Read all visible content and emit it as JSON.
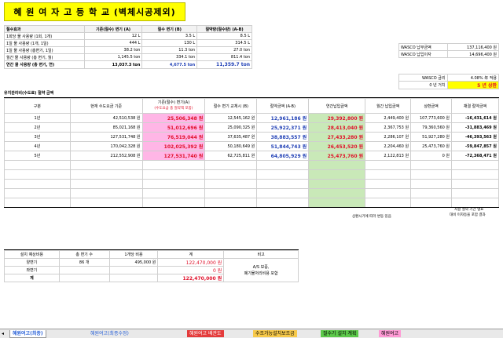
{
  "title": "혜 원 여 자 고 등 학 교 (벽체시공제외)",
  "summary": {
    "headers": [
      "절수효과",
      "기존(절수) 변기 (A)",
      "절수 변기 (B)",
      "절약량(절수량) (A-B)"
    ],
    "rows": [
      {
        "label": "1회당 물 사용량 (1회, 1개)",
        "a": "12 L",
        "b": "3.5 L",
        "c": "8.5 L"
      },
      {
        "label": "1일 물 사용량 (1개, 1일)",
        "a": "444 L",
        "b": "130 L",
        "c": "314.5 L"
      },
      {
        "label": "1일 물 사용량 (총변기, 1일)",
        "a": "38.2 ton",
        "b": "11.3 ton",
        "c": "27.0 ton"
      },
      {
        "label": "월간 물 사용량 (총 변기, 월)",
        "a": "1,145.5 ton",
        "b": "334.1 ton",
        "c": "811.4 ton"
      },
      {
        "label": "연간 물 사용량 (총 변기, 연)",
        "a": "13,037.3 ton",
        "b": "4,677.5 ton",
        "c": "11,359.7 ton"
      }
    ]
  },
  "wasco": {
    "pay_label": "WASCO 납부금액",
    "pay_value": "137,116,400 원",
    "interest_label": "WASCO 납입이자",
    "interest_value": "14,696,400 원",
    "rate_label": "WASCO 금리",
    "rate_value": "4.08% 年 적용",
    "period_label": "0 년 거치",
    "period_value": "5 년 상환"
  },
  "section2_title": "유지관리비(수도료) 절약 금액",
  "fee": {
    "headers": [
      "구분",
      "현재 수도요금 기준",
      "기존(절수) 변기(A)",
      "(수도요금 총 절약액 포함)",
      "절수 변기 교체시 (B)",
      "절약금액 (A-B)",
      "연간납입금액",
      "월간 납입금액",
      "상환금액",
      "채결 절약금액"
    ],
    "rows": [
      {
        "year": "1년",
        "cur": "42,510,538 원",
        "a": "25,506,348 원",
        "b": "12,545,162 원",
        "save": "12,961,186 원",
        "annual": "29,392,800 원",
        "monthly": "2,449,400 원",
        "repay": "107,773,600 원",
        "net": "-16,431,614 원"
      },
      {
        "year": "2년",
        "cur": "85,021,168 원",
        "a": "51,012,696 원",
        "b": "25,090,325 원",
        "save": "25,922,371 원",
        "annual": "28,413,040 원",
        "monthly": "2,367,753 원",
        "repay": "79,360,560 원",
        "net": "-31,883,469 원"
      },
      {
        "year": "3년",
        "cur": "127,531,748 원",
        "a": "76,519,044 원",
        "b": "37,635,487 원",
        "save": "38,883,557 원",
        "annual": "27,433,280 원",
        "monthly": "2,286,107 원",
        "repay": "51,927,280 원",
        "net": "-46,393,563 원"
      },
      {
        "year": "4년",
        "cur": "170,042,328 원",
        "a": "102,025,392 원",
        "b": "50,180,649 원",
        "save": "51,844,743 원",
        "annual": "26,453,520 원",
        "monthly": "2,204,460 원",
        "repay": "25,473,760 원",
        "net": "-59,847,857 원"
      },
      {
        "year": "5년",
        "cur": "212,552,908 원",
        "a": "127,531,740 원",
        "b": "62,725,811 원",
        "save": "64,805,929 원",
        "annual": "25,473,760 원",
        "monthly": "2,122,813 원",
        "repay": "0 원",
        "net": "-72,368,471 원"
      }
    ],
    "note1": "상환시기에 따라 변동 있음",
    "note2": "처결 절약 기간 별표",
    "note3": "대비 이자등을 포함 결과"
  },
  "install": {
    "headers": [
      "설치 예상비용",
      "총 변기 수",
      "1개당 비용",
      "계",
      "비고"
    ],
    "rows": [
      {
        "label": "양변기",
        "count": "86 개",
        "unit": "495,000 원",
        "total": "122,470,000 원"
      },
      {
        "label": "좌변기",
        "count": "",
        "unit": "",
        "total": "0 원"
      },
      {
        "label": "계",
        "count": "",
        "unit": "",
        "total": "122,470,000 원"
      }
    ],
    "remark1": "A/S 보증,",
    "remark2": "폐기물처리비용 포함"
  },
  "tabs": [
    "혜원여고(최종)",
    "혜원여고(최종수정)",
    "혜원여고 배관도",
    "수조가능설치보조금",
    "절수기 설치 계획",
    "혜원여고"
  ]
}
